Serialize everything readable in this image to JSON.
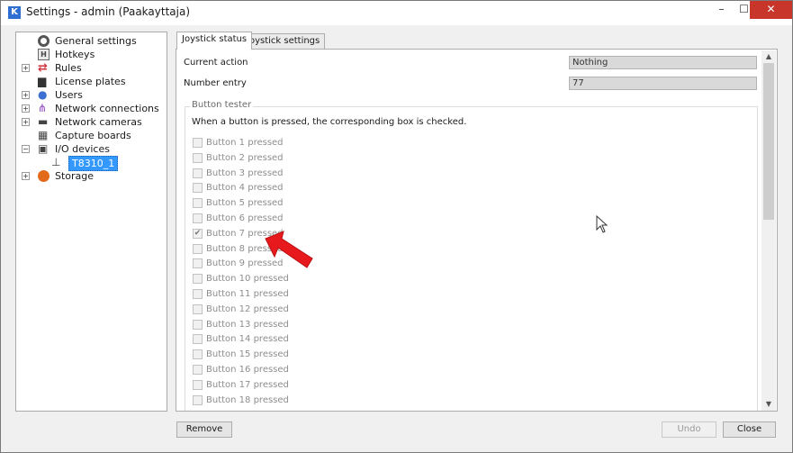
{
  "window": {
    "title": "Settings - admin (Paakayttaja)",
    "app_icon_letter": "K",
    "controls": {
      "minimize": "–",
      "maximize": "☐",
      "close": "✕"
    }
  },
  "tree": {
    "items": [
      {
        "label": "General settings",
        "icon": "gear-icon",
        "expander": ""
      },
      {
        "label": "Hotkeys",
        "icon": "hotkey-icon",
        "expander": ""
      },
      {
        "label": "Rules",
        "icon": "rules-icon",
        "expander": "+"
      },
      {
        "label": "License plates",
        "icon": "car-icon",
        "expander": ""
      },
      {
        "label": "Users",
        "icon": "users-icon",
        "expander": "+"
      },
      {
        "label": "Network connections",
        "icon": "network-icon",
        "expander": "+"
      },
      {
        "label": "Network cameras",
        "icon": "camera-icon",
        "expander": "+"
      },
      {
        "label": "Capture boards",
        "icon": "board-icon",
        "expander": ""
      },
      {
        "label": "I/O devices",
        "icon": "io-device-icon",
        "expander": "−"
      },
      {
        "label": "T8310_1",
        "icon": "joystick-icon",
        "expander": ""
      },
      {
        "label": "Storage",
        "icon": "storage-icon",
        "expander": "+"
      }
    ]
  },
  "tabs": [
    {
      "label": "Joystick status",
      "active": true
    },
    {
      "label": "Joystick settings",
      "active": false
    }
  ],
  "fields": {
    "current_action": {
      "label": "Current action",
      "value": "Nothing"
    },
    "number_entry": {
      "label": "Number entry",
      "value": "77"
    }
  },
  "button_tester": {
    "title": "Button tester",
    "description": "When a button is pressed, the corresponding box is checked.",
    "buttons": [
      {
        "label": "Button 1 pressed",
        "checked": false
      },
      {
        "label": "Button 2 pressed",
        "checked": false
      },
      {
        "label": "Button 3 pressed",
        "checked": false
      },
      {
        "label": "Button 4 pressed",
        "checked": false
      },
      {
        "label": "Button 5 pressed",
        "checked": false
      },
      {
        "label": "Button 6 pressed",
        "checked": false
      },
      {
        "label": "Button 7 pressed",
        "checked": true
      },
      {
        "label": "Button 8 pressed",
        "checked": false
      },
      {
        "label": "Button 9 pressed",
        "checked": false
      },
      {
        "label": "Button 10 pressed",
        "checked": false
      },
      {
        "label": "Button 11 pressed",
        "checked": false
      },
      {
        "label": "Button 12 pressed",
        "checked": false
      },
      {
        "label": "Button 13 pressed",
        "checked": false
      },
      {
        "label": "Button 14 pressed",
        "checked": false
      },
      {
        "label": "Button 15 pressed",
        "checked": false
      },
      {
        "label": "Button 16 pressed",
        "checked": false
      },
      {
        "label": "Button 17 pressed",
        "checked": false
      },
      {
        "label": "Button 18 pressed",
        "checked": false
      }
    ]
  },
  "footer": {
    "remove": "Remove",
    "undo": "Undo",
    "close": "Close"
  },
  "colors": {
    "annotation_arrow": "#e8191c",
    "selection": "#3399ff",
    "close_button": "#c7352b"
  }
}
